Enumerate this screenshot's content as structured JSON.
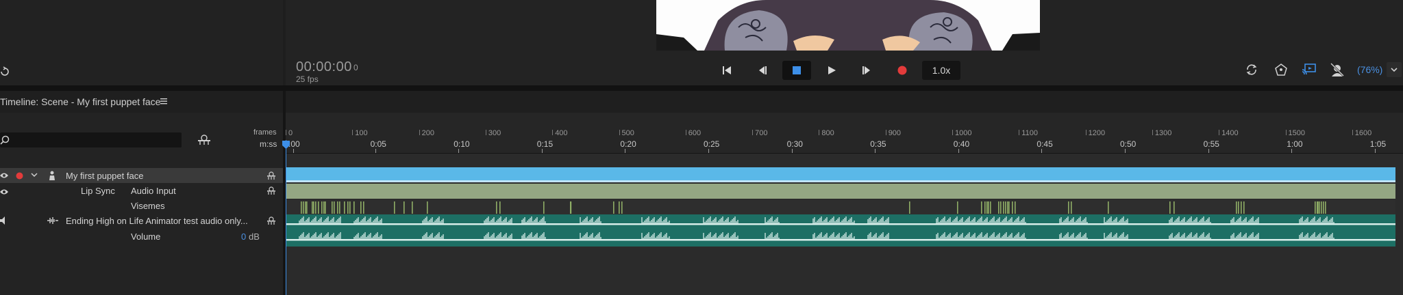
{
  "transport": {
    "timecode": "00:00:00",
    "frame": "0",
    "fps": "25 fps",
    "speed": "1.0x"
  },
  "zoom": "(76%)",
  "timeline": {
    "title": "Timeline: Scene - My first puppet face",
    "frames_label": "frames",
    "time_label": "m:ss",
    "frame_ticks": [
      "0",
      "100",
      "200",
      "300",
      "400",
      "500",
      "600",
      "700",
      "800",
      "900",
      "1000",
      "1100",
      "1200",
      "1300",
      "1400",
      "1500",
      "1600"
    ],
    "time_ticks": [
      ":00",
      "0:05",
      "0:10",
      "0:15",
      "0:20",
      "0:25",
      "0:30",
      "0:35",
      "0:40",
      "0:45",
      "0:50",
      "0:55",
      "1:00",
      "1:05"
    ]
  },
  "layers": {
    "puppet": "My first puppet face",
    "lip_sync": "Lip Sync",
    "audio_input": "Audio Input",
    "visemes": "Visemes",
    "audio_track": "Ending High on Life Animator test audio only...",
    "volume_label": "Volume",
    "volume_value": "0",
    "volume_unit": "dB"
  },
  "colors": {
    "accent": "#4a90e2",
    "puppet_bar": "#5ab8e8",
    "lipsync_bar": "#94a783",
    "viseme_mark": "#8fae66",
    "audio_bar": "#1d6f64",
    "record": "#e33b3b"
  }
}
